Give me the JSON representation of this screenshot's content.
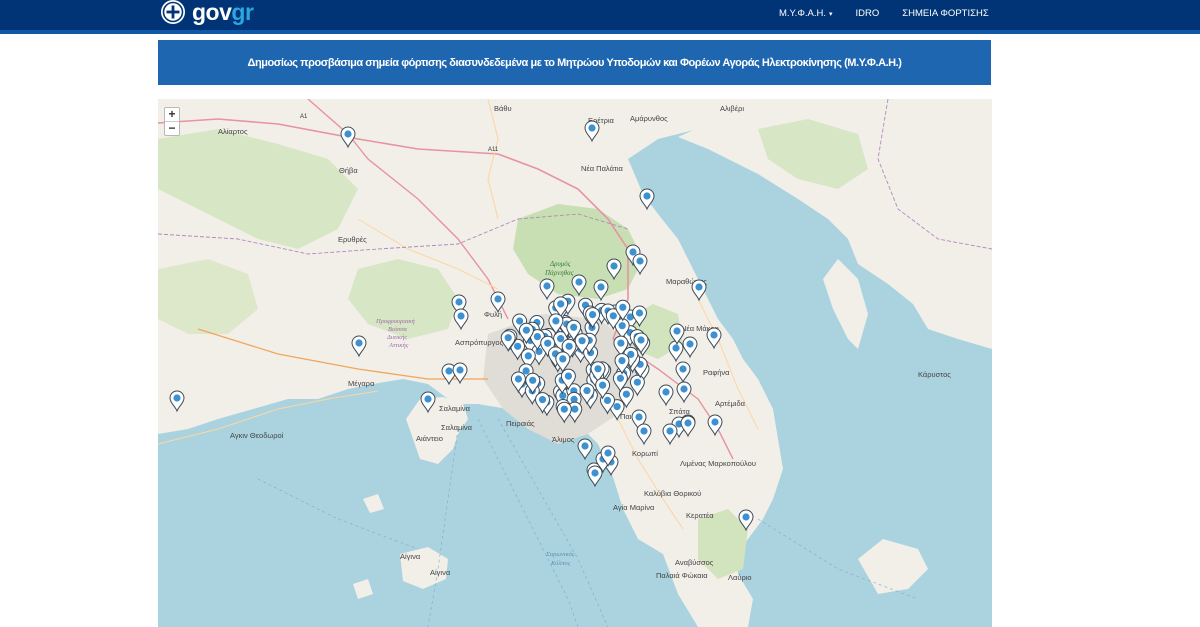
{
  "header": {
    "logo_gov": "gov",
    "logo_gr": "gr",
    "nav": [
      {
        "label": "Μ.Υ.Φ.Α.Η.",
        "has_dropdown": true
      },
      {
        "label": "IDRO",
        "has_dropdown": false
      },
      {
        "label": "ΣΗΜΕΙΑ ΦΟΡΤΙΣΗΣ",
        "has_dropdown": false
      }
    ],
    "colors": {
      "bar": "#003476",
      "stripe": "#0f5aa8",
      "accent": "#2ba6de"
    }
  },
  "banner": {
    "title": "Δημοσίως προσβάσιμα σημεία φόρτισης διασυνδεδεμένα με το Μητρώου Υποδομών και Φορέων Αγοράς Ηλεκτροκίνησης (Μ.Υ.Φ.Α.Η.)",
    "color": "#1f66b0"
  },
  "map": {
    "zoom_in": "+",
    "zoom_out": "−",
    "place_labels": [
      "Αλίαρτος",
      "Θήβα",
      "Ερυθρές",
      "Μέγαρα",
      "Σαλαμίνα",
      "Αιάντειο",
      "Σαλαμίνα",
      "Πειραιάς",
      "Αγκιν Θεοδωροί",
      "Αίγινα",
      "Αίγινα",
      "Φυλή",
      "Ασπρόπυργος",
      "Ερέτρια",
      "Αμάρυνθος",
      "Αλιβέρι",
      "Νέα Παλάτια",
      "Μαραθώνας",
      "Νέα Μάκρη",
      "Ραφήνα",
      "Αρτέμιδα",
      "Σπάτα",
      "Παιανία",
      "Κορωπί",
      "Λιμένας Μαρκοπούλου",
      "Καλύβια Θορικού",
      "Αγία Μαρίνα",
      "Κερατέα",
      "Αναβύσσος",
      "Παλαιά Φώκαια",
      "Λαύριο",
      "Κάρυστος",
      "Άλιμος",
      "Βάθυ"
    ],
    "road_labels": [
      "A1",
      "A11"
    ],
    "park_labels": [
      "Δρυμός",
      "Πάρνηθας"
    ],
    "region_labels": [
      "Προφρουριακή",
      "Βιόσσα",
      "Δυτικής",
      "Αττικής"
    ],
    "sea_labels": [
      "Σαρωνικός",
      "Κόλπος"
    ],
    "pin_count": 132,
    "pin_color": "#3d91d0"
  }
}
